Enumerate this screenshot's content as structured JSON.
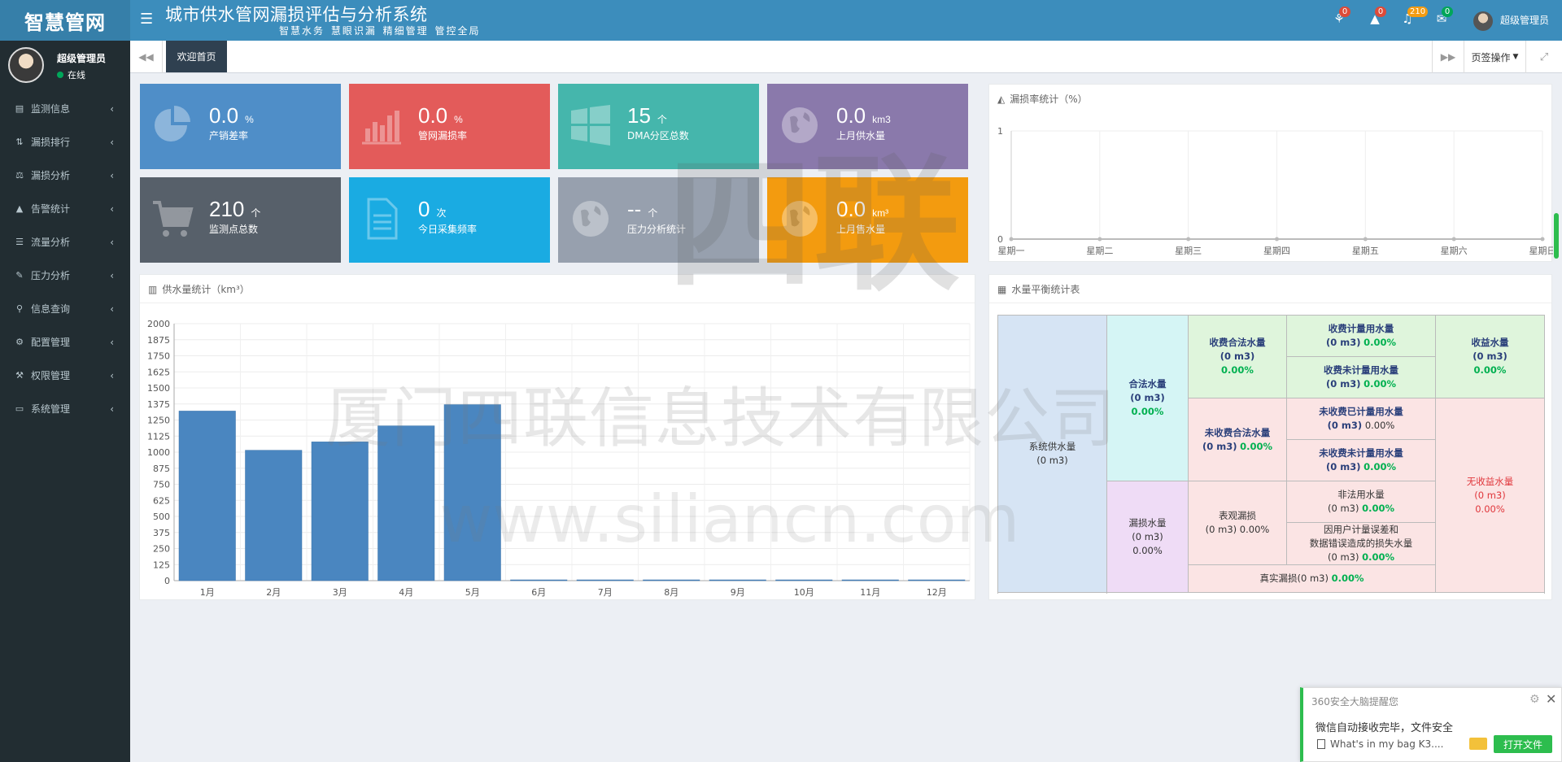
{
  "header": {
    "logo": "智慧管网",
    "title": "城市供水管网漏损评估与分析系统",
    "subtitle": "智慧水务 慧眼识漏 精细管理 管控全局",
    "badges": {
      "chat": "0",
      "alert": "0",
      "bell": "210",
      "mail": "0"
    },
    "user": "超级管理员"
  },
  "sidebar": {
    "username": "超级管理员",
    "status": "在线",
    "items": [
      {
        "label": "监测信息",
        "icon": "book-icon"
      },
      {
        "label": "漏损排行",
        "icon": "sort-icon"
      },
      {
        "label": "漏损分析",
        "icon": "balance-icon"
      },
      {
        "label": "告警统计",
        "icon": "warning-icon"
      },
      {
        "label": "流量分析",
        "icon": "list-icon"
      },
      {
        "label": "压力分析",
        "icon": "edit-icon"
      },
      {
        "label": "信息查询",
        "icon": "search-icon"
      },
      {
        "label": "配置管理",
        "icon": "cogs-icon"
      },
      {
        "label": "权限管理",
        "icon": "gavel-icon"
      },
      {
        "label": "系统管理",
        "icon": "desktop-icon"
      }
    ]
  },
  "tabs": {
    "active": "欢迎首页",
    "ops": "页签操作"
  },
  "cards": [
    {
      "value": "0.0",
      "unit": "%",
      "label": "产销差率",
      "color": "#4f8ec8",
      "icon": "pie-chart-icon"
    },
    {
      "value": "0.0",
      "unit": "%",
      "label": "管网漏损率",
      "color": "#e35b5a",
      "icon": "bar-chart-icon"
    },
    {
      "value": "15",
      "unit": "个",
      "label": "DMA分区总数",
      "color": "#45b6ac",
      "icon": "windows-icon"
    },
    {
      "value": "0.0",
      "unit": "km3",
      "label": "上月供水量",
      "color": "#8a79ab",
      "icon": "globe-icon"
    },
    {
      "value": "210",
      "unit": "个",
      "label": "监测点总数",
      "color": "#57606a",
      "icon": "cart-icon"
    },
    {
      "value": "0",
      "unit": "次",
      "label": "今日采集频率",
      "color": "#1aabe2",
      "icon": "file-icon"
    },
    {
      "value": "--",
      "unit": "个",
      "label": "压力分析统计",
      "color": "#97a0ae",
      "icon": "globe-icon"
    },
    {
      "value": "0.0",
      "unit": "km³",
      "label": "上月售水量",
      "color": "#f39b0f",
      "icon": "globe-icon"
    }
  ],
  "leak_panel": {
    "title": "漏损率统计（%）"
  },
  "supply_panel": {
    "title": "供水量统计（km³）"
  },
  "balance_panel": {
    "title": "水量平衡统计表",
    "system_supply": "系统供水量",
    "legal": "合法水量",
    "leak": "漏损水量",
    "billed_legal": "收费合法水量",
    "unbilled_legal": "未收费合法水量",
    "billed_metered": "收费计量用水量",
    "billed_unmetered": "收费未计量用水量",
    "unbilled_metered": "未收费已计量用水量",
    "unbilled_unmetered": "未收费未计量用水量",
    "apparent_loss": "表观漏损",
    "illegal_use": "非法用水量",
    "meter_error_1": "因用户计量误差和",
    "meter_error_2": "数据错误造成的损失水量",
    "real_loss": "真实漏损",
    "revenue": "收益水量",
    "non_revenue": "无收益水量",
    "vol": "(0 m3)",
    "pct": "0.00%"
  },
  "watermark": {
    "logo": "四联",
    "company": "厦门四联信息技术有限公司",
    "url": "www.siliancn.com"
  },
  "notification": {
    "title": "360安全大脑提醒您",
    "message": "微信自动接收完毕，文件安全",
    "file": "What's in my bag K3....",
    "button": "打开文件"
  },
  "chart_data": [
    {
      "type": "line",
      "title": "漏损率统计（%）",
      "categories": [
        "星期一",
        "星期二",
        "星期三",
        "星期四",
        "星期五",
        "星期六",
        "星期日"
      ],
      "series": [
        {
          "values": [
            0,
            0,
            0,
            0,
            0,
            0,
            0
          ]
        }
      ],
      "ylim": [
        0,
        1
      ],
      "yticks": [
        "0",
        "1"
      ],
      "grid": true
    },
    {
      "type": "bar",
      "title": "供水量统计（km³）",
      "categories": [
        "1月",
        "2月",
        "3月",
        "4月",
        "5月",
        "6月",
        "7月",
        "8月",
        "9月",
        "10月",
        "11月",
        "12月"
      ],
      "values": [
        1320,
        1015,
        1080,
        1205,
        1370,
        0,
        0,
        0,
        0,
        0,
        0,
        0
      ],
      "ylim": [
        0,
        2000
      ],
      "yticks": [
        0,
        125,
        250,
        375,
        500,
        625,
        750,
        875,
        1000,
        1125,
        1250,
        1375,
        1500,
        1625,
        1750,
        1875,
        2000
      ],
      "bar_color": "#4a86c0",
      "grid": true
    }
  ]
}
